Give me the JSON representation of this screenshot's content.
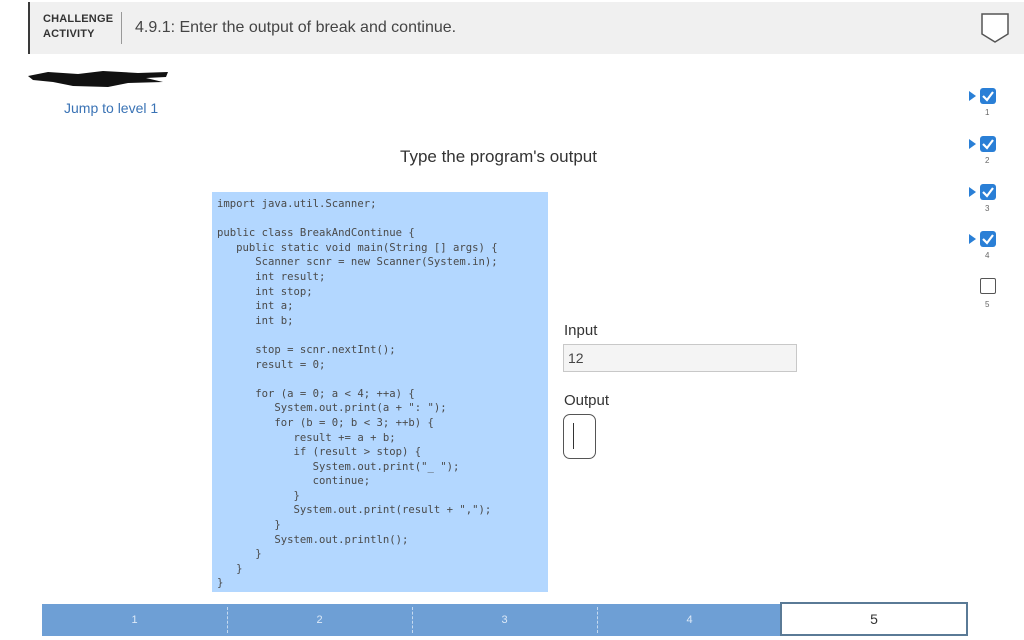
{
  "header": {
    "activity_label_line1": "CHALLENGE",
    "activity_label_line2": "ACTIVITY",
    "title": "4.9.1: Enter the output of break and continue.",
    "badge_icon": "empty-shield-icon"
  },
  "jump_link": "Jump to level 1",
  "prompt": "Type the program's output",
  "code": "import java.util.Scanner;\n\npublic class BreakAndContinue {\n   public static void main(String [] args) {\n      Scanner scnr = new Scanner(System.in);\n      int result;\n      int stop;\n      int a;\n      int b;\n\n      stop = scnr.nextInt();\n      result = 0;\n\n      for (a = 0; a < 4; ++a) {\n         System.out.print(a + \": \");\n         for (b = 0; b < 3; ++b) {\n            result += a + b;\n            if (result > stop) {\n               System.out.print(\"_ \");\n               continue;\n            }\n            System.out.print(result + \",\");\n         }\n         System.out.println();\n      }\n   }\n}",
  "input": {
    "label": "Input",
    "value": "12"
  },
  "output": {
    "label": "Output",
    "value": ""
  },
  "levels": [
    {
      "number": "1",
      "completed": true
    },
    {
      "number": "2",
      "completed": true
    },
    {
      "number": "3",
      "completed": true
    },
    {
      "number": "4",
      "completed": true
    },
    {
      "number": "5",
      "completed": false
    }
  ],
  "progress": {
    "segments": [
      "1",
      "2",
      "3",
      "4"
    ],
    "current": "5"
  },
  "colors": {
    "code_bg": "#b3d7ff",
    "level_done": "#2a7fd6",
    "progress_bar": "#6e9fd5",
    "link": "#3a73b5"
  }
}
